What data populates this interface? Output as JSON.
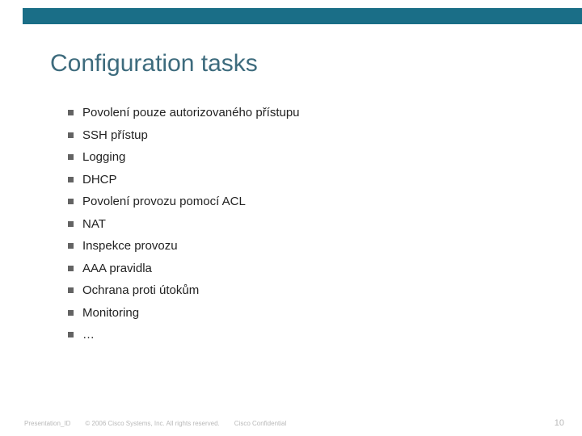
{
  "title": "Configuration tasks",
  "items": [
    "Povolení pouze autorizovaného přístupu",
    "SSH přístup",
    "Logging",
    "DHCP",
    "Povolení provozu pomocí ACL",
    "NAT",
    "Inspekce provozu",
    "AAA pravidla",
    "Ochrana proti útokům",
    "Monitoring",
    "…"
  ],
  "footer": {
    "left": "Presentation_ID",
    "copyright": "© 2006 Cisco Systems, Inc. All rights reserved.",
    "confidential": "Cisco Confidential",
    "page": "10"
  }
}
